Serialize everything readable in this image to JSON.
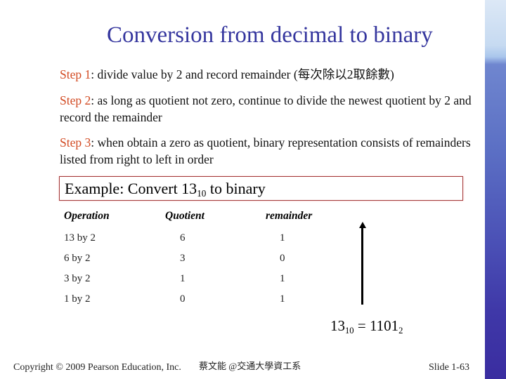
{
  "slide": {
    "title": "Conversion from decimal to binary",
    "steps": [
      {
        "label": "Step 1",
        "text": ": divide value by 2 and record remainder (每次除以2取餘數)"
      },
      {
        "label": "Step 2",
        "text": ": as long as quotient not zero, continue to divide the newest quotient by 2 and record the remainder"
      },
      {
        "label": "Step 3",
        "text": ": when obtain a zero as quotient, binary representation consists of remainders listed from right to left in order"
      }
    ],
    "example": {
      "prefix": "Example: Convert 13",
      "base": "10",
      "suffix": " to binary"
    },
    "table": {
      "headers": [
        "Operation",
        "Quotient",
        "remainder"
      ],
      "rows": [
        [
          "13 by 2",
          "6",
          "1"
        ],
        [
          "6 by 2",
          "3",
          "0"
        ],
        [
          "3 by 2",
          "1",
          "1"
        ],
        [
          "1 by 2",
          "0",
          "1"
        ]
      ]
    },
    "result": {
      "decimal": "13",
      "decimal_base": "10",
      "equals": " = ",
      "binary": "1101",
      "binary_base": "2"
    },
    "footer": {
      "copyright": "Copyright © 2009 Pearson Education, Inc.",
      "author": "蔡文能 @交通大學資工系",
      "slide_number": "Slide 1-63"
    },
    "colors": {
      "title": "#35369e",
      "step_label": "#d24a22",
      "example_border": "#a33a3a"
    }
  }
}
